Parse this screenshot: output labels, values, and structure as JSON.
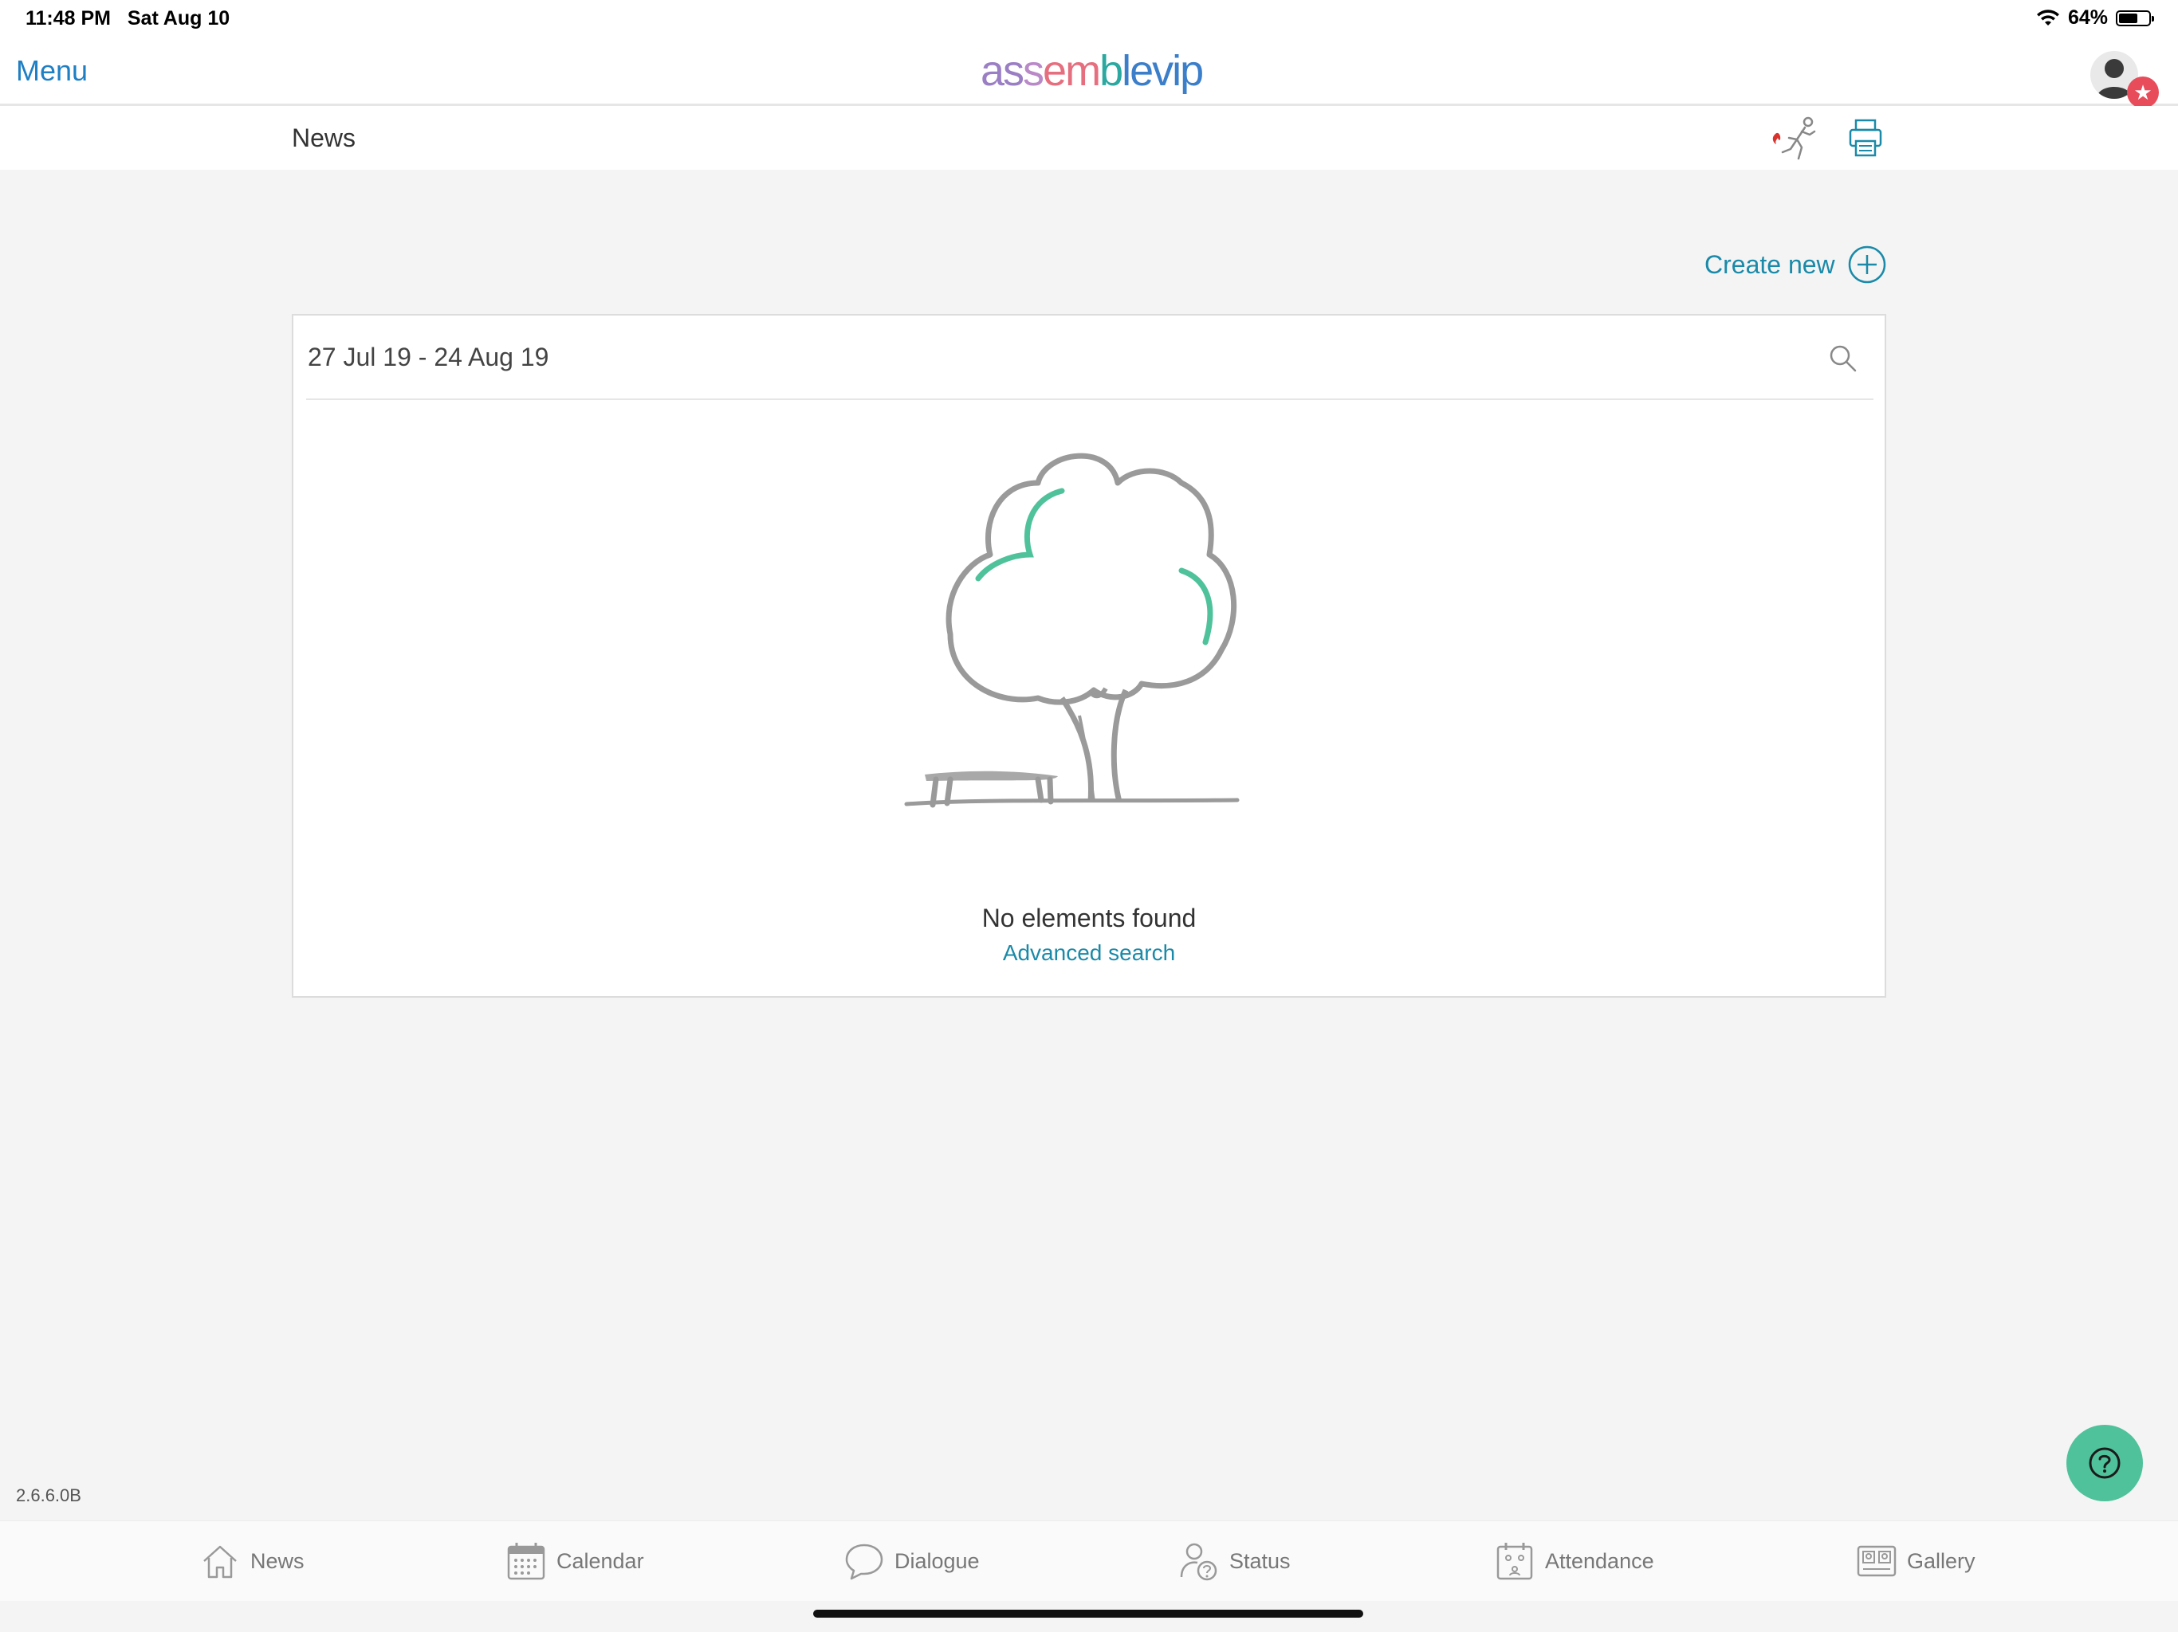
{
  "status_bar": {
    "time": "11:48 PM",
    "date": "Sat Aug 10",
    "battery": "64%",
    "battery_level": 0.64
  },
  "nav": {
    "menu_label": "Menu",
    "logo": {
      "letters": [
        "a",
        "s",
        "s",
        "e",
        "m",
        "b",
        "l",
        "e",
        "v",
        "i",
        "p"
      ],
      "colors": [
        "#9b7fc4",
        "#9b7fc4",
        "#b989c8",
        "#e56f7f",
        "#e56f7f",
        "#2ba8a0",
        "#3b7ec9",
        "#3b7ec9",
        "#3b7ec9",
        "#3b7ec9",
        "#3b7ec9"
      ]
    },
    "notification_badge": "★"
  },
  "sub_header": {
    "title": "News",
    "fire_icon": "fire-drill-icon",
    "print_icon": "print-icon"
  },
  "actions": {
    "create_new_label": "Create new"
  },
  "search_card": {
    "date_range": "27 Jul 19 - 24 Aug 19",
    "empty_text": "No elements found",
    "advanced_search_label": "Advanced search"
  },
  "version": "2.6.6.0B",
  "tabs": [
    {
      "label": "News",
      "icon": "home-icon"
    },
    {
      "label": "Calendar",
      "icon": "calendar-icon"
    },
    {
      "label": "Dialogue",
      "icon": "speech-bubble-icon"
    },
    {
      "label": "Status",
      "icon": "person-question-icon"
    },
    {
      "label": "Attendance",
      "icon": "attendance-icon"
    },
    {
      "label": "Gallery",
      "icon": "gallery-icon"
    }
  ],
  "colors": {
    "accent": "#1a8aa8",
    "menu": "#1f7fc4",
    "help_fab": "#4fc29b",
    "badge": "#e84c5a",
    "background": "#f4f4f4"
  }
}
